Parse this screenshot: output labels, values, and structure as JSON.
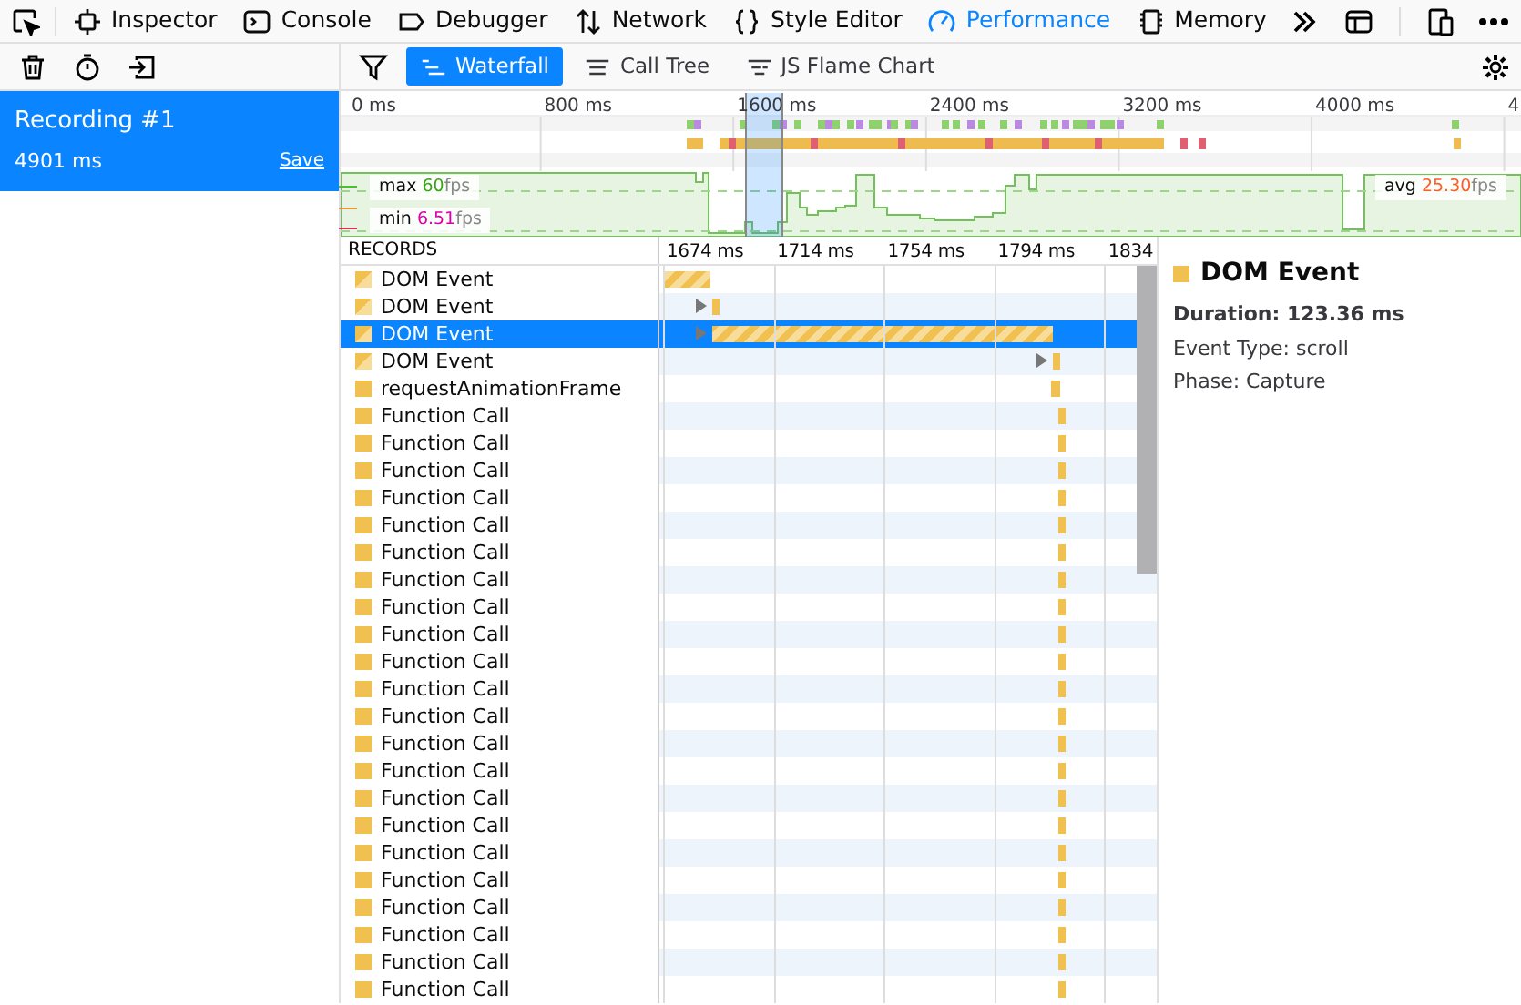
{
  "toolbox_tabs": [
    {
      "kind": "inspector",
      "label": "Inspector",
      "selected": false
    },
    {
      "kind": "console",
      "label": "Console",
      "selected": false
    },
    {
      "kind": "debugger",
      "label": "Debugger",
      "selected": false
    },
    {
      "kind": "network",
      "label": "Network",
      "selected": false
    },
    {
      "kind": "style",
      "label": "Style Editor",
      "selected": false
    },
    {
      "kind": "performance",
      "label": "Performance",
      "selected": true
    },
    {
      "kind": "memory",
      "label": "Memory",
      "selected": false
    }
  ],
  "views": [
    {
      "label": "Waterfall",
      "selected": true
    },
    {
      "label": "Call Tree",
      "selected": false
    },
    {
      "label": "JS Flame Chart",
      "selected": false
    }
  ],
  "recordings": [
    {
      "title": "Recording #1",
      "duration": "4901 ms",
      "action": "Save",
      "selected": true
    }
  ],
  "overview": {
    "ticks": [
      "0 ms",
      "800 ms",
      "1600 ms",
      "2400 ms",
      "3200 ms",
      "4000 ms",
      "4"
    ],
    "fps_max": {
      "label": "max",
      "value": "60",
      "unit": "fps"
    },
    "fps_min": {
      "label": "min",
      "value": "6.51",
      "unit": "fps"
    },
    "fps_avg": {
      "label": "avg",
      "value": "25.30",
      "unit": "fps"
    }
  },
  "records": {
    "header": "RECORDS",
    "ticks": [
      "1674 ms",
      "1714 ms",
      "1754 ms",
      "1794 ms",
      "1834"
    ],
    "rows": [
      {
        "name": "DOM Event",
        "selected": false,
        "expandable": false
      },
      {
        "name": "DOM Event",
        "selected": false,
        "expandable": true
      },
      {
        "name": "DOM Event",
        "selected": true,
        "expandable": true
      },
      {
        "name": "DOM Event",
        "selected": false,
        "expandable": true
      },
      {
        "name": "requestAnimationFrame",
        "selected": false,
        "expandable": false
      },
      {
        "name": "Function Call",
        "selected": false,
        "expandable": false
      },
      {
        "name": "Function Call",
        "selected": false,
        "expandable": false
      },
      {
        "name": "Function Call",
        "selected": false,
        "expandable": false
      },
      {
        "name": "Function Call",
        "selected": false,
        "expandable": false
      },
      {
        "name": "Function Call",
        "selected": false,
        "expandable": false
      },
      {
        "name": "Function Call",
        "selected": false,
        "expandable": false
      },
      {
        "name": "Function Call",
        "selected": false,
        "expandable": false
      },
      {
        "name": "Function Call",
        "selected": false,
        "expandable": false
      },
      {
        "name": "Function Call",
        "selected": false,
        "expandable": false
      },
      {
        "name": "Function Call",
        "selected": false,
        "expandable": false
      },
      {
        "name": "Function Call",
        "selected": false,
        "expandable": false
      },
      {
        "name": "Function Call",
        "selected": false,
        "expandable": false
      },
      {
        "name": "Function Call",
        "selected": false,
        "expandable": false
      },
      {
        "name": "Function Call",
        "selected": false,
        "expandable": false
      },
      {
        "name": "Function Call",
        "selected": false,
        "expandable": false
      },
      {
        "name": "Function Call",
        "selected": false,
        "expandable": false
      },
      {
        "name": "Function Call",
        "selected": false,
        "expandable": false
      },
      {
        "name": "Function Call",
        "selected": false,
        "expandable": false
      },
      {
        "name": "Function Call",
        "selected": false,
        "expandable": false
      },
      {
        "name": "Function Call",
        "selected": false,
        "expandable": false
      },
      {
        "name": "Function Call",
        "selected": false,
        "expandable": false
      },
      {
        "name": "Function Call",
        "selected": false,
        "expandable": false
      }
    ]
  },
  "details": {
    "title": "DOM Event",
    "duration": "Duration: 123.36 ms",
    "lines": [
      "Event Type: scroll",
      "Phase: Capture"
    ]
  }
}
